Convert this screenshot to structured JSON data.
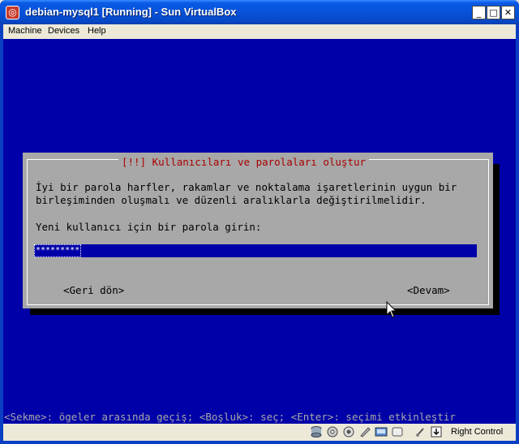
{
  "window": {
    "title": "debian-mysql1 [Running] - Sun VirtualBox"
  },
  "menubar": {
    "items": [
      "Machine",
      "Devices",
      "Help"
    ]
  },
  "dialog": {
    "title": "[!!] Kullanıcıları ve parolaları oluştur",
    "description_line1": "İyi bir parola harfler, rakamlar ve noktalama işaretlerinin uygun bir",
    "description_line2": "birleşiminden oluşmalı ve düzenli aralıklarla değiştirilmelidir.",
    "prompt": "Yeni kullanıcı için bir parola girin:",
    "password_value": "*********",
    "back_label": "<Geri dön>",
    "continue_label": "<Devam>"
  },
  "hint": "<Sekme>: ögeler arasında geçiş; <Boşluk>: seç; <Enter>: seçimi etkinleştir",
  "statusbar": {
    "host_key": "Right Control",
    "icons": [
      "hard-disk-icon",
      "optical-drive-icon",
      "audio-icon",
      "network-icon",
      "usb-icon",
      "shared-folders-icon",
      "mouse-integration-icon",
      "keyboard-capture-icon"
    ]
  },
  "colors": {
    "guest_background": "#0000a8",
    "dialog_background": "#a8a8a8",
    "dialog_title": "#a80000",
    "titlebar": "#0752d9"
  }
}
